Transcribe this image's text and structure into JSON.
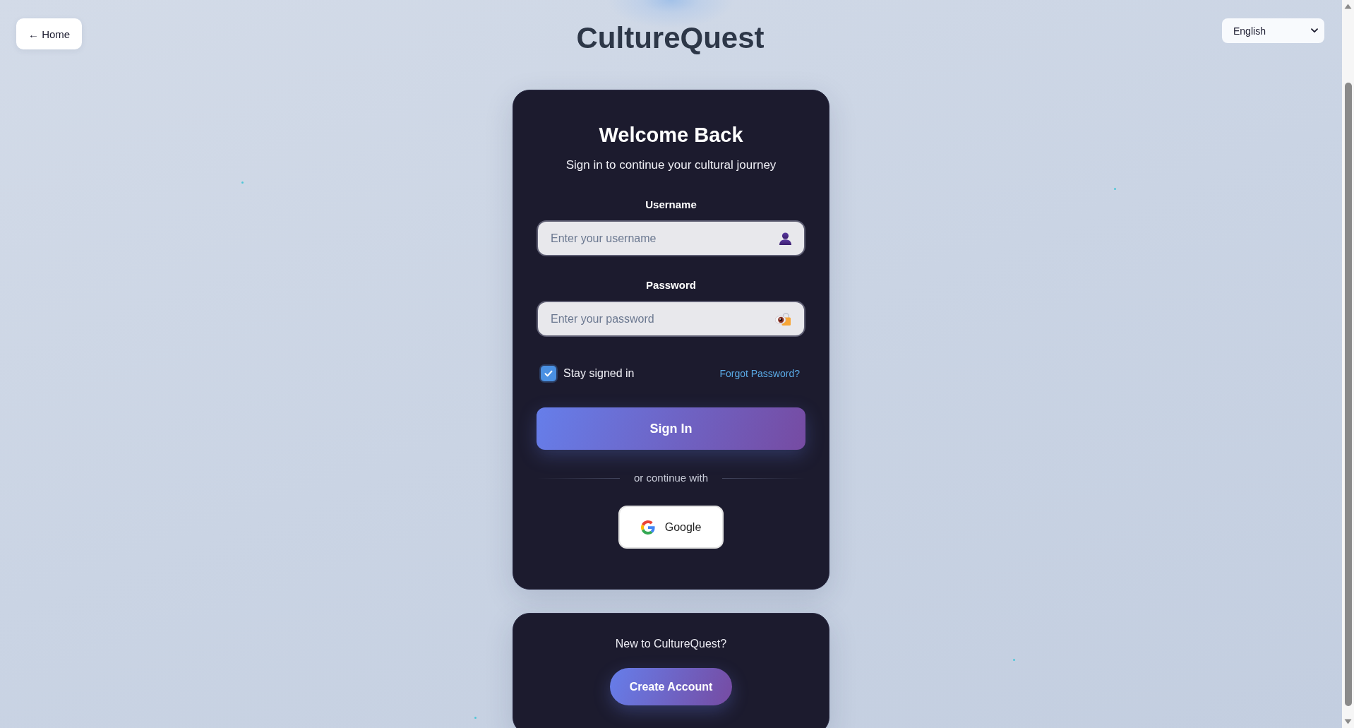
{
  "header": {
    "back_link": "← Home",
    "title": "CultureQuest",
    "language_select": {
      "value": "English"
    }
  },
  "login_card": {
    "title": "Welcome Back",
    "subtitle": "Sign in to continue your cultural journey",
    "fields": [
      {
        "kind": "user",
        "label": "Username",
        "placeholder": "Enter your username"
      },
      {
        "kind": "password",
        "label": "Password",
        "placeholder": "Enter your password"
      }
    ],
    "remember": {
      "label": "Stay signed in",
      "checked": true
    },
    "forgot_link": "Forgot Password?",
    "submit_button": "Sign In",
    "divider_text": "or continue with",
    "social_buttons": [
      {
        "kind": "google",
        "label": "Google"
      }
    ]
  },
  "signup_card": {
    "prompt": "New to CultureQuest?",
    "button": "Create Account"
  }
}
